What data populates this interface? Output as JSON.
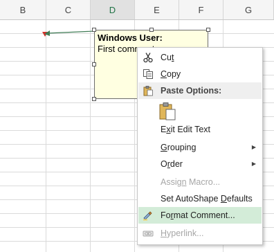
{
  "columns": [
    "B",
    "C",
    "D",
    "E",
    "F",
    "G"
  ],
  "comment": {
    "author": "Windows User:",
    "text": "First comment"
  },
  "menu": {
    "cut": {
      "pre": "Cu",
      "ul": "t",
      "post": ""
    },
    "copy": {
      "pre": "",
      "ul": "C",
      "post": "opy"
    },
    "paste_options": "Paste Options:",
    "exit_edit_text": {
      "pre": "E",
      "ul": "x",
      "post": "it Edit Text"
    },
    "grouping": {
      "pre": "",
      "ul": "G",
      "post": "rouping"
    },
    "order": {
      "pre": "O",
      "ul": "r",
      "post": "der"
    },
    "assign_macro": {
      "pre": "Assig",
      "ul": "n",
      "post": " Macro..."
    },
    "set_autoshape_defaults": {
      "pre": "Set AutoShape ",
      "ul": "D",
      "post": "efaults"
    },
    "format_comment": {
      "pre": "Fo",
      "ul": "r",
      "post": "mat Comment..."
    },
    "hyperlink": {
      "pre": "",
      "ul": "H",
      "post": "yperlink..."
    }
  },
  "colors": {
    "comment_bg": "#ffffe1",
    "highlight": "#d3ecd8",
    "indicator": "#d1312a",
    "arrow": "#3e7b54"
  },
  "icons": {
    "cut": "scissors-icon",
    "copy": "copy-icon",
    "paste_options": "clipboard-icon",
    "paste_button": "clipboard-paste-icon",
    "format_comment": "format-comment-icon",
    "hyperlink": "hyperlink-icon"
  }
}
